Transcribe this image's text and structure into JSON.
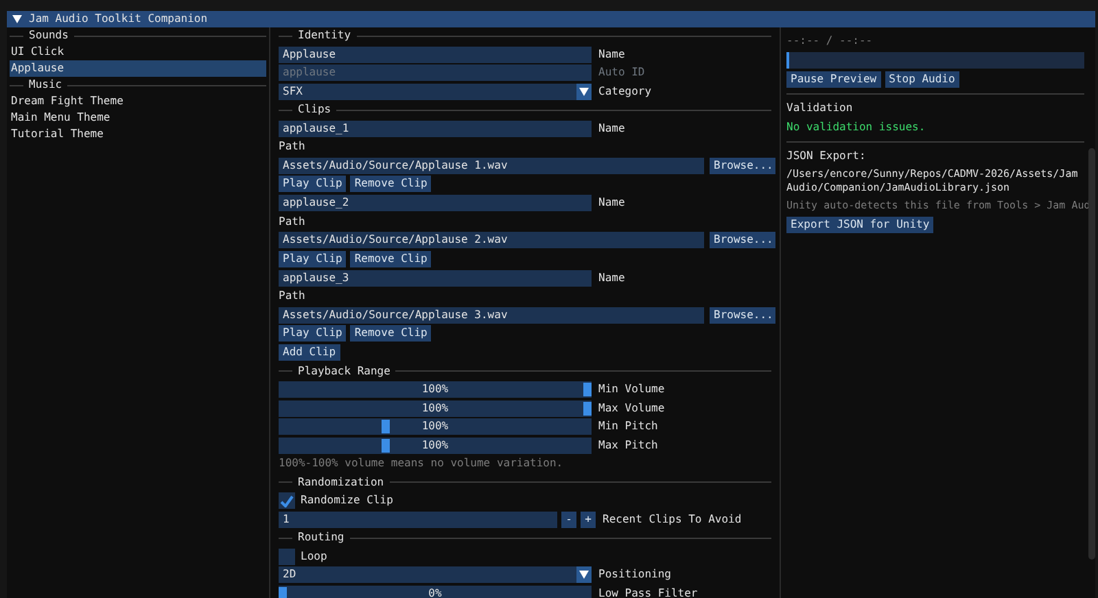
{
  "window": {
    "title": "Jam Audio Toolkit Companion"
  },
  "sidebar": {
    "sections": [
      {
        "header": "Sounds",
        "items": [
          {
            "label": "UI Click",
            "selected": false
          },
          {
            "label": "Applause",
            "selected": true
          }
        ]
      },
      {
        "header": "Music",
        "items": [
          {
            "label": "Dream Fight Theme",
            "selected": false
          },
          {
            "label": "Main Menu Theme",
            "selected": false
          },
          {
            "label": "Tutorial Theme",
            "selected": false
          }
        ]
      }
    ]
  },
  "editor": {
    "identity": {
      "header": "Identity",
      "fields": [
        {
          "kind": "text",
          "value": "Applause",
          "label": "Name",
          "disabled": false
        },
        {
          "kind": "text",
          "value": "applause",
          "label": "Auto ID",
          "disabled": true
        },
        {
          "kind": "combo",
          "value": "SFX",
          "label": "Category",
          "disabled": false
        }
      ]
    },
    "clips": {
      "header": "Clips",
      "items": [
        {
          "name": "applause_1",
          "name_label": "Name",
          "path_label": "Path",
          "path": "Assets/Audio/Source/Applause 1.wav",
          "browse": "Browse...",
          "buttons": [
            "Play Clip",
            "Remove Clip"
          ]
        },
        {
          "name": "applause_2",
          "name_label": "Name",
          "path_label": "Path",
          "path": "Assets/Audio/Source/Applause 2.wav",
          "browse": "Browse...",
          "buttons": [
            "Play Clip",
            "Remove Clip"
          ]
        },
        {
          "name": "applause_3",
          "name_label": "Name",
          "path_label": "Path",
          "path": "Assets/Audio/Source/Applause 3.wav",
          "browse": "Browse...",
          "buttons": [
            "Play Clip",
            "Remove Clip"
          ]
        }
      ],
      "add_button": "Add Clip"
    },
    "playback_range": {
      "header": "Playback Range",
      "sliders": [
        {
          "value_text": "100%",
          "level": 1,
          "label": "Min Volume"
        },
        {
          "value_text": "100%",
          "level": 1,
          "label": "Max Volume"
        },
        {
          "value_text": "100%",
          "level": 0.34,
          "label": "Min Pitch"
        },
        {
          "value_text": "100%",
          "level": 0.34,
          "label": "Max Pitch"
        }
      ],
      "note": "100%-100% volume means no volume variation."
    },
    "randomization": {
      "header": "Randomization",
      "checkbox": {
        "label": "Randomize Clip",
        "checked": true
      },
      "stepper": {
        "value": "1",
        "minus": "-",
        "plus": "+",
        "label": "Recent Clips To Avoid"
      }
    },
    "routing": {
      "header": "Routing",
      "checkbox": {
        "label": "Loop",
        "checked": false
      },
      "combo": {
        "value": "2D",
        "label": "Positioning"
      },
      "slider": {
        "value_text": "0%",
        "level": 0,
        "label": "Low Pass Filter"
      }
    }
  },
  "preview": {
    "time": "--:-- / --:--",
    "progress": {
      "level": 0
    },
    "buttons": [
      "Pause Preview",
      "Stop Audio"
    ]
  },
  "validation": {
    "title": "Validation",
    "message": "No validation issues."
  },
  "export": {
    "label": "JSON Export:",
    "path": "/Users/encore/Sunny/Repos/CADMV-2026/Assets/Jam Audio/Companion/JamAudioLibrary.json",
    "hint": "Unity auto-detects this file from Tools > Jam Aud",
    "button": "Export JSON for Unity"
  }
}
